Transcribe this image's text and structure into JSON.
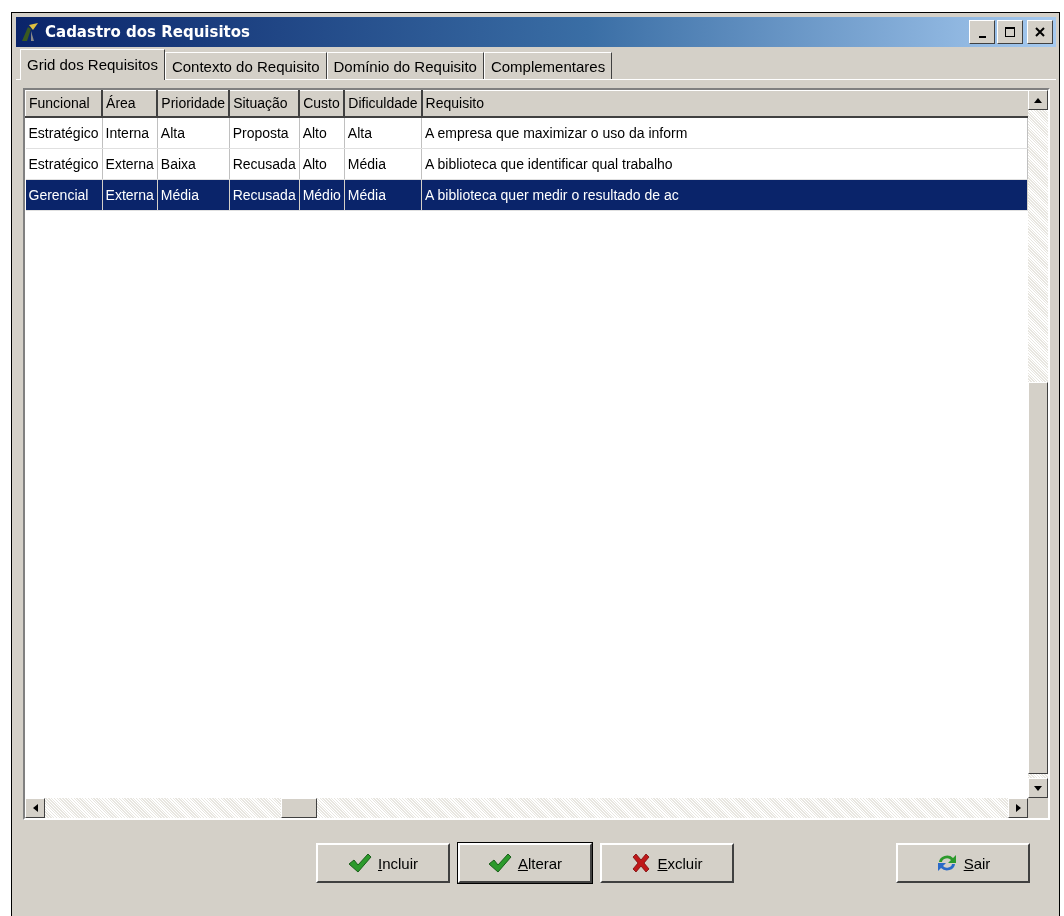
{
  "window": {
    "title": "Cadastro dos Requisitos"
  },
  "tabs": [
    {
      "label": "Grid dos Requisitos",
      "selected": true
    },
    {
      "label": "Contexto do Requisito",
      "selected": false
    },
    {
      "label": "Domínio do Requisito",
      "selected": false
    },
    {
      "label": "Complementares",
      "selected": false
    }
  ],
  "table": {
    "columns": [
      "Funcional",
      "Área",
      "Prioridade",
      "Situação",
      "Custo",
      "Dificuldade",
      "Requisito"
    ],
    "rows": [
      {
        "cells": [
          "Estratégico",
          "Interna",
          "Alta",
          "Proposta",
          "Alto",
          "Alta",
          "A empresa que maximizar o uso da inform"
        ],
        "selected": false
      },
      {
        "cells": [
          "Estratégico",
          "Externa",
          "Baixa",
          "Recusada",
          "Alto",
          "Média",
          "A biblioteca que identificar qual trabalho"
        ],
        "selected": false
      },
      {
        "cells": [
          "Gerencial",
          "Externa",
          "Média",
          "Recusada",
          "Médio",
          "Média",
          "A biblioteca quer medir o resultado de ac"
        ],
        "selected": true
      }
    ]
  },
  "buttons": [
    {
      "label": "Incluir",
      "kind": "check",
      "default": false
    },
    {
      "label": "Alterar",
      "kind": "check",
      "default": true
    },
    {
      "label": "Excluir",
      "kind": "cross",
      "default": false
    },
    {
      "label": "Sair",
      "kind": "refresh",
      "default": false
    }
  ]
}
